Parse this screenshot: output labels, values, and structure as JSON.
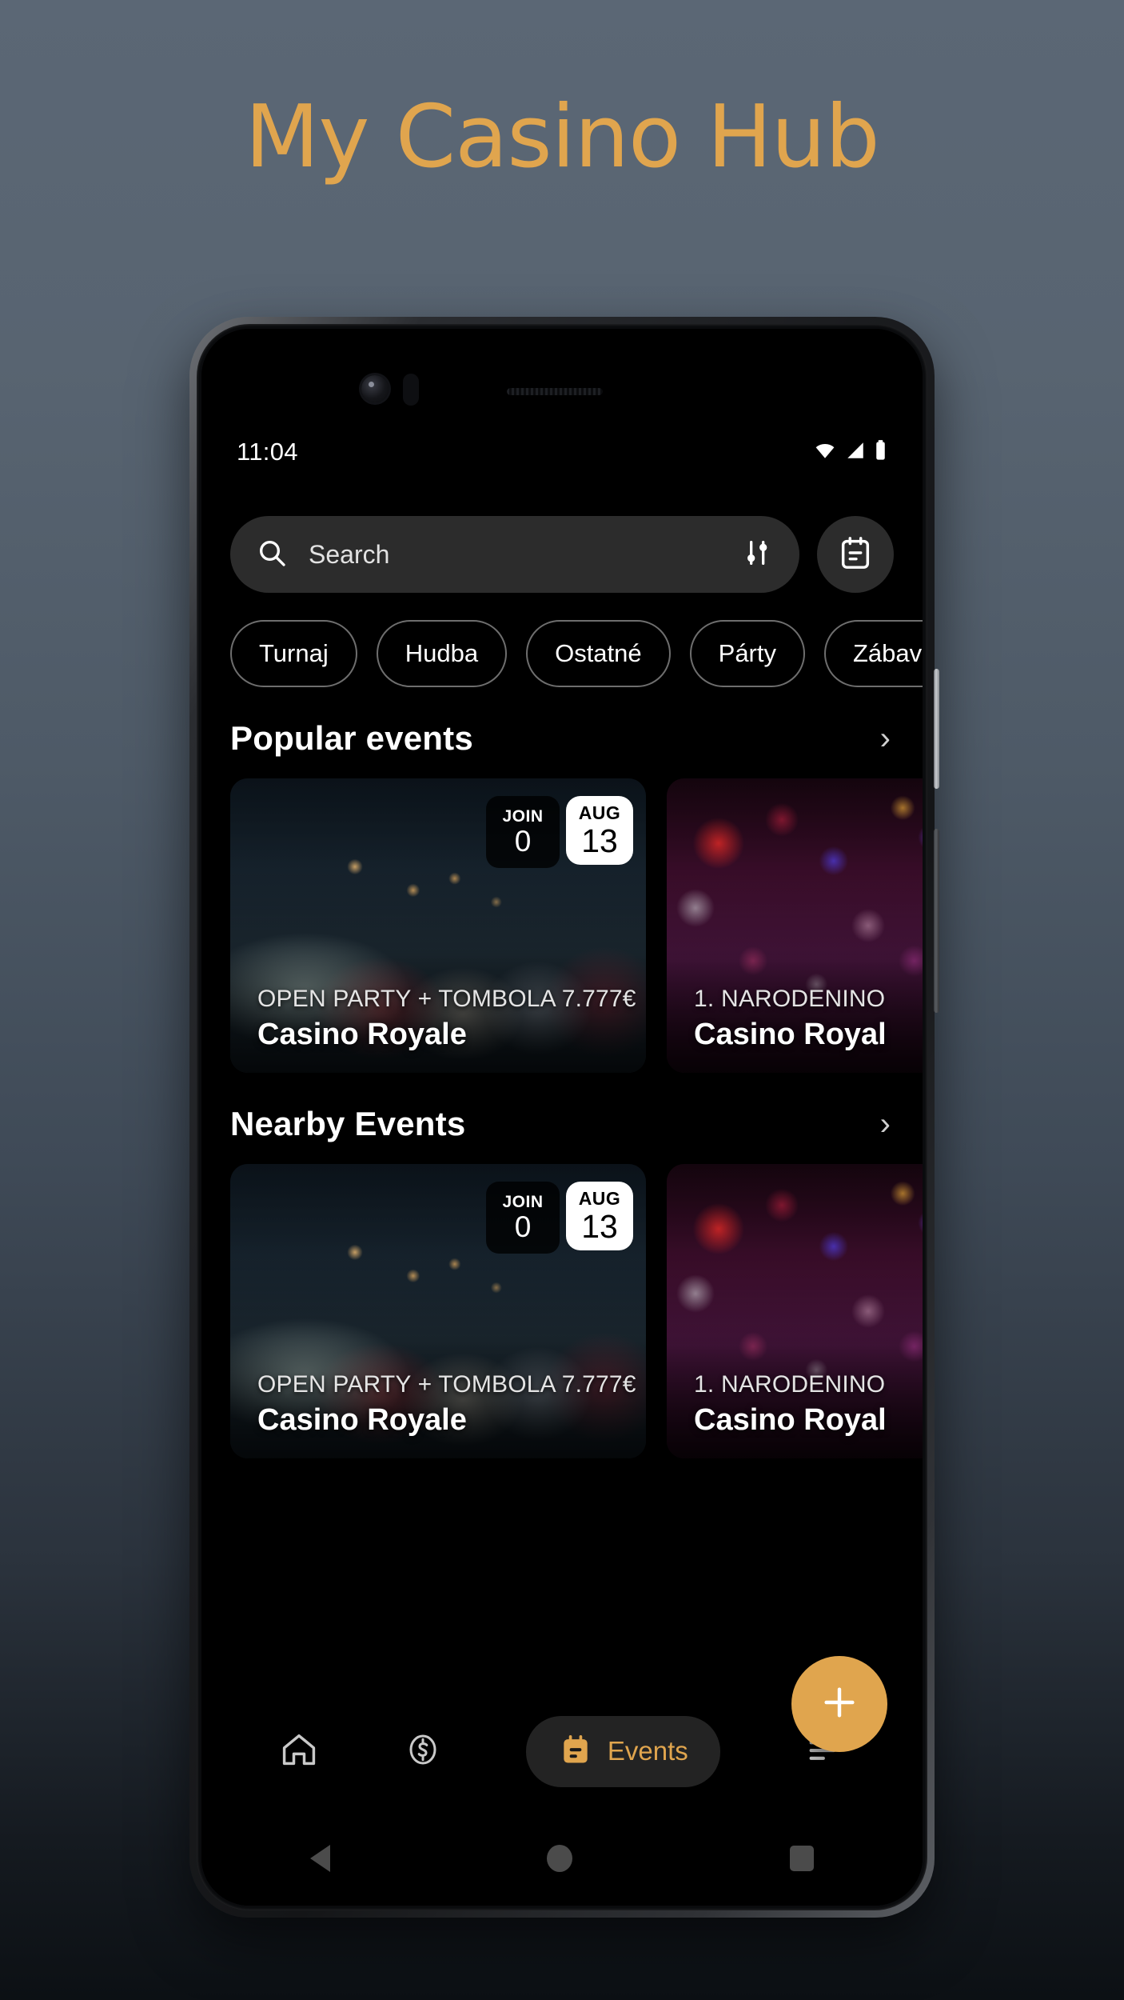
{
  "promo": {
    "title": "My Casino Hub",
    "accent_color": "#e0a54e"
  },
  "status_bar": {
    "time": "11:04",
    "icons": [
      "wifi-icon",
      "cellular-signal-icon",
      "battery-icon"
    ]
  },
  "search": {
    "placeholder": "Search",
    "search_icon": "search-icon",
    "filter_icon": "sort-filter-icon",
    "calendar_button_icon": "calendar-event-icon"
  },
  "chips": [
    {
      "label": "Turnaj"
    },
    {
      "label": "Hudba"
    },
    {
      "label": "Ostatné"
    },
    {
      "label": "Párty"
    },
    {
      "label": "Zábava"
    }
  ],
  "sections": [
    {
      "title": "Popular events",
      "chevron": "›",
      "cards": [
        {
          "subtitle": "OPEN PARTY + TOMBOLA 7.777€",
          "title": "Casino Royale",
          "join_label": "JOIN",
          "join_count": "0",
          "date_month": "AUG",
          "date_day": "13",
          "image": "crowd-party-photo"
        },
        {
          "subtitle": "1. NARODENINO",
          "title": "Casino Royal",
          "image": "bokeh-lights-photo"
        }
      ]
    },
    {
      "title": "Nearby Events",
      "chevron": "›",
      "cards": [
        {
          "subtitle": "OPEN PARTY + TOMBOLA 7.777€",
          "title": "Casino Royale",
          "join_label": "JOIN",
          "join_count": "0",
          "date_month": "AUG",
          "date_day": "13",
          "image": "crowd-party-photo"
        },
        {
          "subtitle": "1. NARODENINO",
          "title": "Casino Royal",
          "image": "bokeh-lights-photo"
        }
      ]
    }
  ],
  "fab": {
    "icon": "plus-icon",
    "color": "#e0a54e"
  },
  "bottom_nav": {
    "items": [
      {
        "icon": "home-icon",
        "label": "",
        "active": false
      },
      {
        "icon": "dollar-coin-icon",
        "label": "",
        "active": false
      },
      {
        "icon": "calendar-event-icon",
        "label": "Events",
        "active": true
      },
      {
        "icon": "menu-list-icon",
        "label": "",
        "active": false
      }
    ]
  },
  "android_nav": {
    "back": "back-triangle-icon",
    "home": "home-circle-icon",
    "recents": "recents-square-icon"
  }
}
